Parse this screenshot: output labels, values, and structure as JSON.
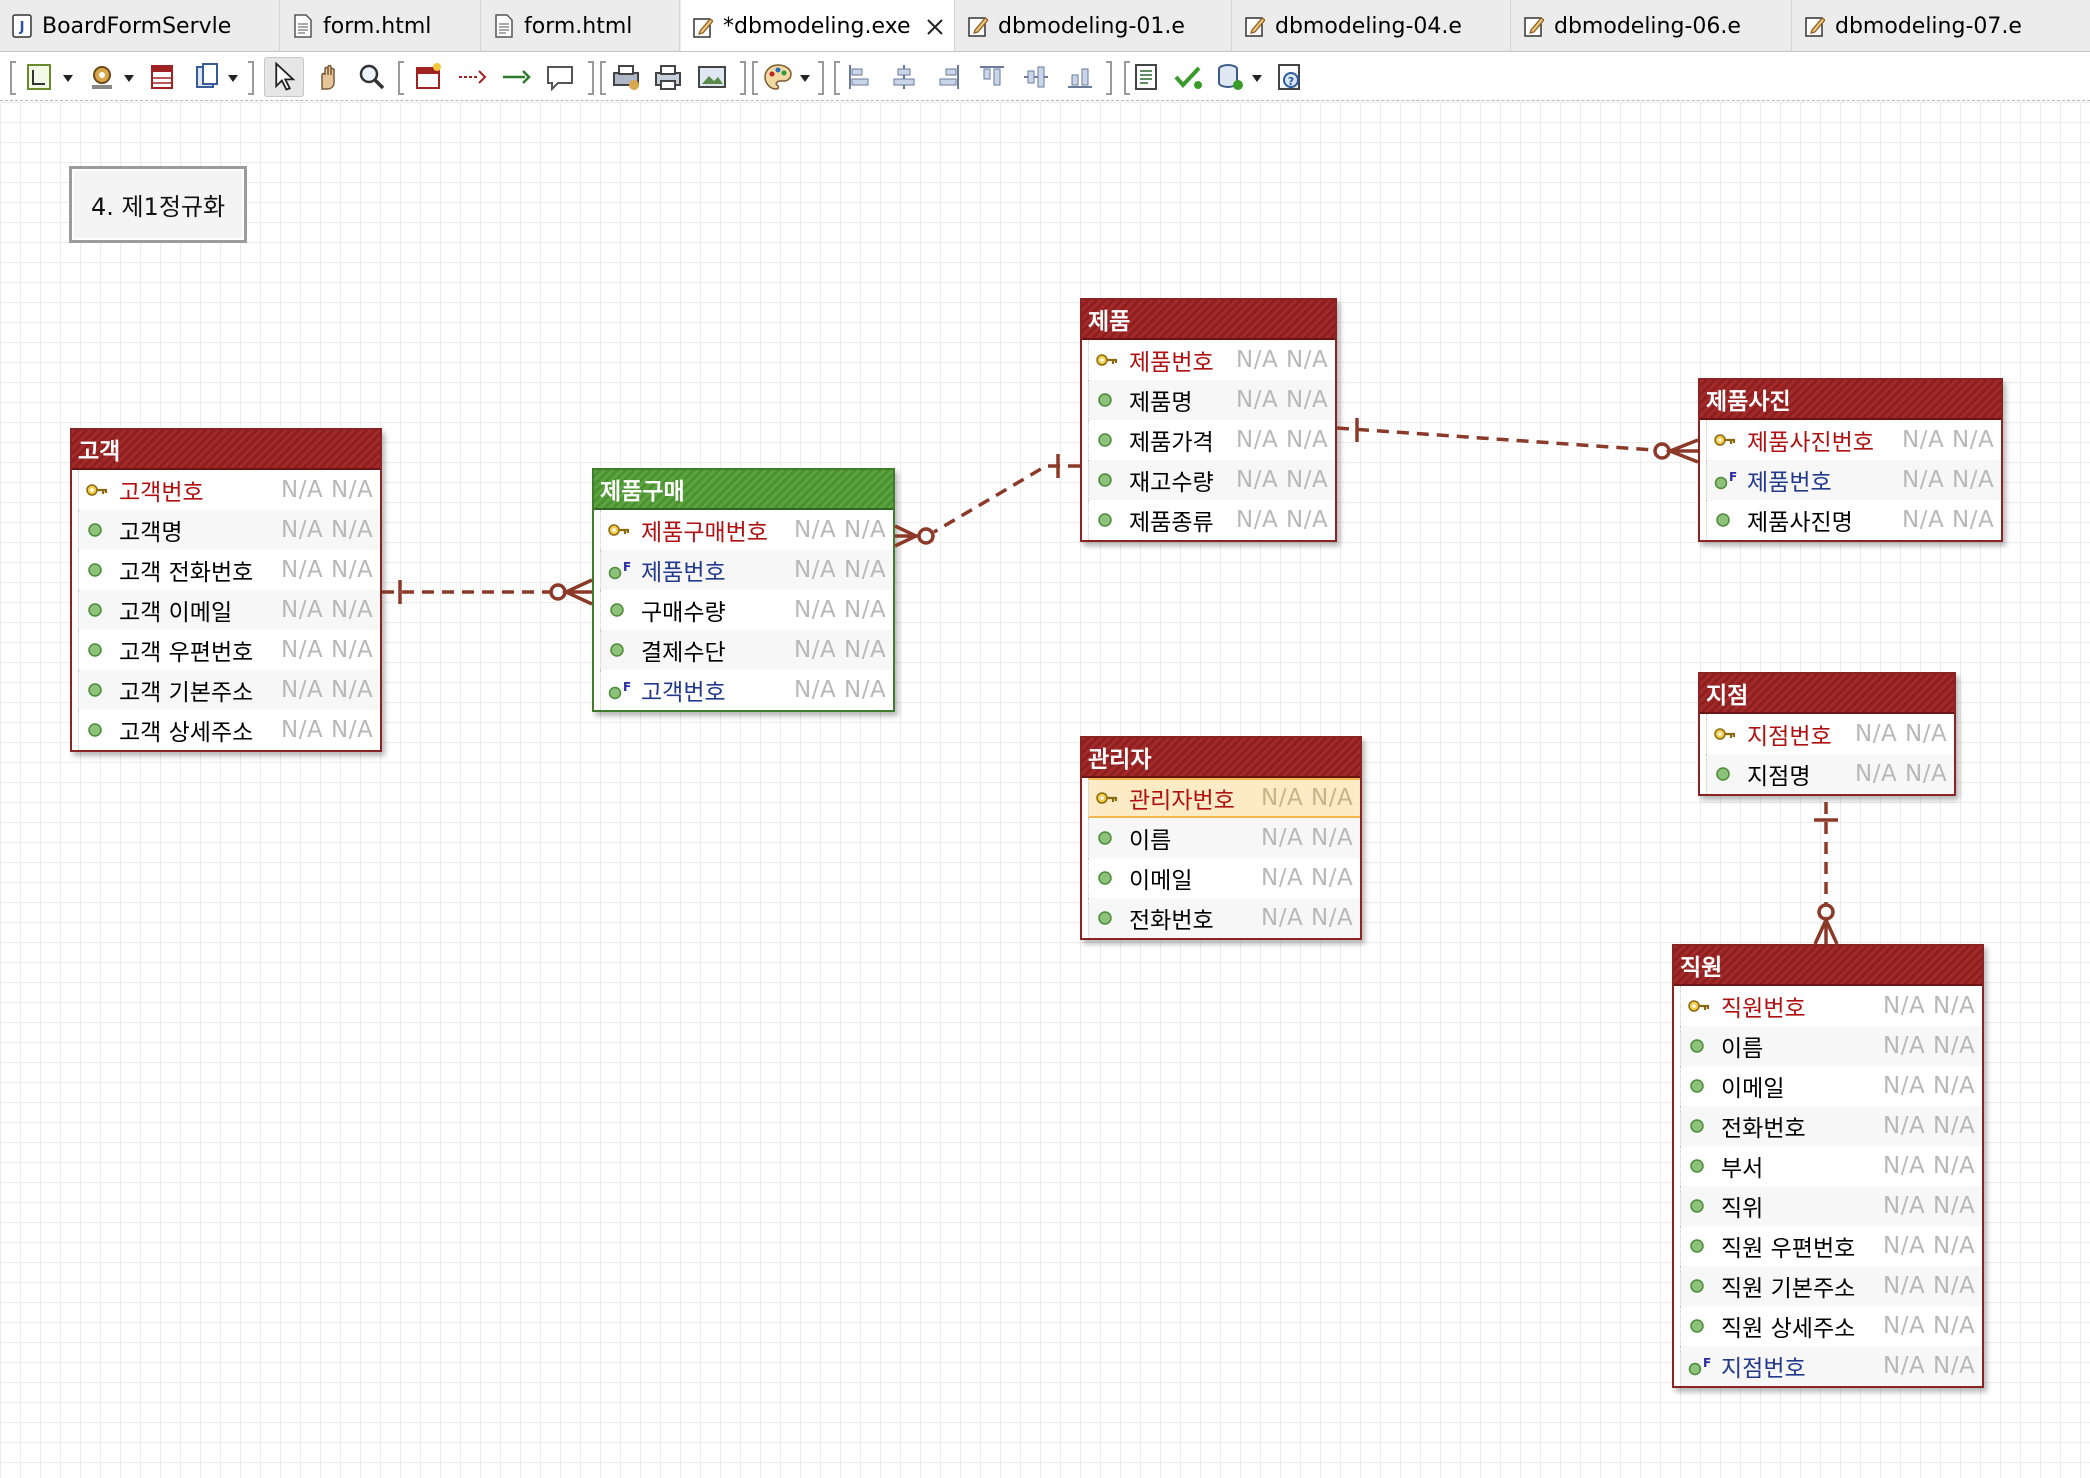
{
  "tabs": [
    {
      "label": "BoardFormServle",
      "icon": "java-file-icon",
      "active": false
    },
    {
      "label": "form.html",
      "icon": "html-file-icon",
      "active": false
    },
    {
      "label": "form.html",
      "icon": "html-file-icon",
      "active": false
    },
    {
      "label": "*dbmodeling.exe",
      "icon": "erd-file-icon",
      "active": true
    },
    {
      "label": "dbmodeling-01.e",
      "icon": "erd-file-icon",
      "active": false
    },
    {
      "label": "dbmodeling-04.e",
      "icon": "erd-file-icon",
      "active": false
    },
    {
      "label": "dbmodeling-06.e",
      "icon": "erd-file-icon",
      "active": false
    },
    {
      "label": "dbmodeling-07.e",
      "icon": "erd-file-icon",
      "active": false
    }
  ],
  "toolbar_icons": [
    "layout-icon",
    "settings-icon",
    "table-icon",
    "copy-icon",
    "select-arrow-icon",
    "hand-icon",
    "zoom-icon",
    "new-table-icon",
    "relation-dashed-icon",
    "relation-solid-icon",
    "note-icon",
    "print-icon",
    "printer-icon",
    "image-export-icon",
    "color-palette-icon",
    "align-left-icon",
    "align-center-icon",
    "align-right-icon",
    "align-top-icon",
    "align-middle-icon",
    "align-bottom-icon",
    "ddl-icon",
    "validate-icon",
    "database-sync-icon",
    "help-icon"
  ],
  "note": {
    "text": "4. 제1정규화"
  },
  "null_label": "N/A",
  "colors": {
    "entity_border": "#8a2424",
    "entity_green": "#3d7d2c",
    "relation": "#8b3a2a",
    "pk_text": "#b01010",
    "fk_text": "#233a8c"
  },
  "entities": [
    {
      "id": "customer",
      "name": "고객",
      "color": "red",
      "columns": [
        {
          "name": "고객번호",
          "type": "pk"
        },
        {
          "name": "고객명",
          "type": "attr"
        },
        {
          "name": "고객 전화번호",
          "type": "attr"
        },
        {
          "name": "고객 이메일",
          "type": "attr"
        },
        {
          "name": "고객 우편번호",
          "type": "attr"
        },
        {
          "name": "고객 기본주소",
          "type": "attr"
        },
        {
          "name": "고객 상세주소",
          "type": "attr"
        }
      ]
    },
    {
      "id": "purchase",
      "name": "제품구매",
      "color": "green",
      "columns": [
        {
          "name": "제품구매번호",
          "type": "pk"
        },
        {
          "name": "제품번호",
          "type": "fk"
        },
        {
          "name": "구매수량",
          "type": "attr"
        },
        {
          "name": "결제수단",
          "type": "attr"
        },
        {
          "name": "고객번호",
          "type": "fk"
        }
      ]
    },
    {
      "id": "product",
      "name": "제품",
      "color": "red",
      "columns": [
        {
          "name": "제품번호",
          "type": "pk"
        },
        {
          "name": "제품명",
          "type": "attr"
        },
        {
          "name": "제품가격",
          "type": "attr"
        },
        {
          "name": "재고수량",
          "type": "attr"
        },
        {
          "name": "제품종류",
          "type": "attr"
        }
      ]
    },
    {
      "id": "photo",
      "name": "제품사진",
      "color": "red",
      "columns": [
        {
          "name": "제품사진번호",
          "type": "pk"
        },
        {
          "name": "제품번호",
          "type": "fk"
        },
        {
          "name": "제품사진명",
          "type": "attr"
        }
      ]
    },
    {
      "id": "admin",
      "name": "관리자",
      "color": "red",
      "columns": [
        {
          "name": "관리자번호",
          "type": "pk",
          "selected": true
        },
        {
          "name": "이름",
          "type": "attr"
        },
        {
          "name": "이메일",
          "type": "attr"
        },
        {
          "name": "전화번호",
          "type": "attr"
        }
      ]
    },
    {
      "id": "branch",
      "name": "지점",
      "color": "red",
      "columns": [
        {
          "name": "지점번호",
          "type": "pk"
        },
        {
          "name": "지점명",
          "type": "attr"
        }
      ]
    },
    {
      "id": "employee",
      "name": "직원",
      "color": "red",
      "columns": [
        {
          "name": "직원번호",
          "type": "pk"
        },
        {
          "name": "이름",
          "type": "attr"
        },
        {
          "name": "이메일",
          "type": "attr"
        },
        {
          "name": "전화번호",
          "type": "attr"
        },
        {
          "name": "부서",
          "type": "attr"
        },
        {
          "name": "직위",
          "type": "attr"
        },
        {
          "name": "직원 우편번호",
          "type": "attr"
        },
        {
          "name": "직원 기본주소",
          "type": "attr"
        },
        {
          "name": "직원 상세주소",
          "type": "attr"
        },
        {
          "name": "지점번호",
          "type": "fk"
        }
      ]
    }
  ],
  "relations": [
    {
      "from": "customer",
      "to": "purchase",
      "cardinality": "one-to-zero-or-many"
    },
    {
      "from": "product",
      "to": "purchase",
      "cardinality": "one-to-zero-or-many"
    },
    {
      "from": "product",
      "to": "photo",
      "cardinality": "one-to-zero-or-many"
    },
    {
      "from": "branch",
      "to": "employee",
      "cardinality": "one-to-zero-or-many"
    }
  ]
}
